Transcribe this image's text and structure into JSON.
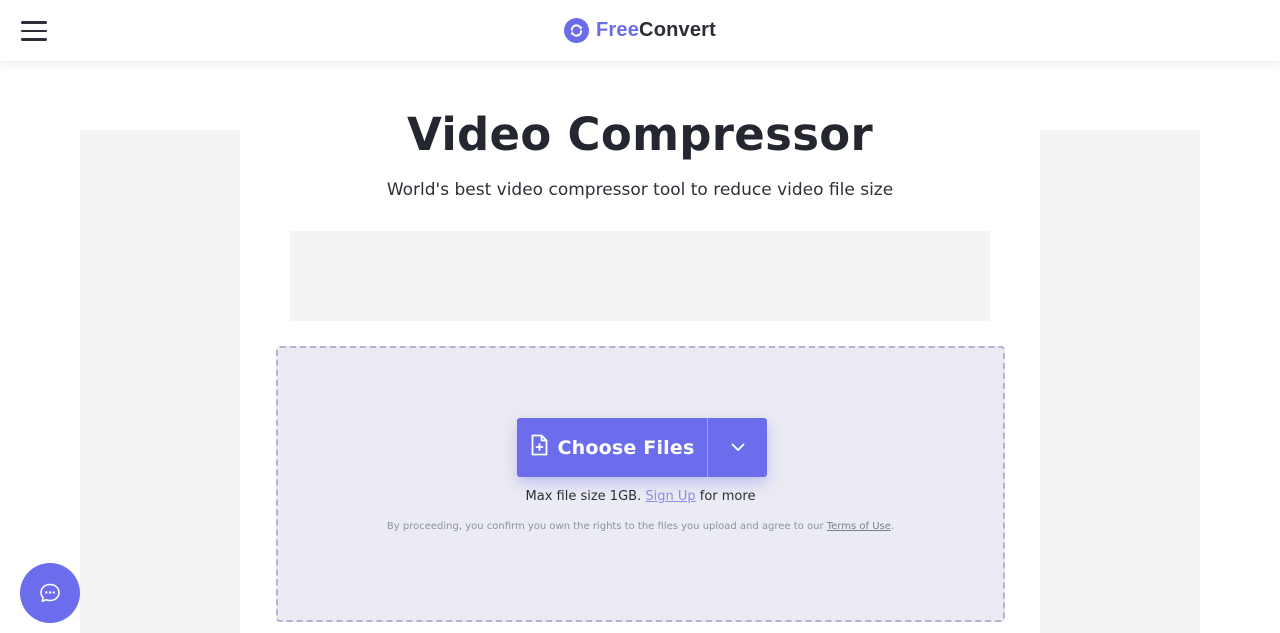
{
  "header": {
    "logo": {
      "free": "Free",
      "convert": "Convert",
      "icon": "refresh-cycle-icon"
    },
    "menu_icon": "hamburger-menu-icon"
  },
  "main": {
    "title": "Video Compressor",
    "subtitle": "World's best video compressor tool to reduce video file size"
  },
  "upload": {
    "choose_label": "Choose Files",
    "choose_icon": "file-add-icon",
    "dropdown_icon": "chevron-down-icon",
    "max_prefix": "Max file size 1GB.",
    "signup_link": "Sign Up",
    "max_suffix": "for more",
    "terms_prefix": "By proceeding, you confirm you own the rights to the files you upload and agree to our",
    "terms_link": "Terms of Use",
    "terms_suffix": "."
  },
  "chat": {
    "icon": "chat-bubble-icon"
  },
  "colors": {
    "accent": "#6c6ded",
    "dropzone_bg": "#ebebf3",
    "dropzone_border": "#b6b2cf",
    "placeholder_bg": "#f3f3f3"
  }
}
